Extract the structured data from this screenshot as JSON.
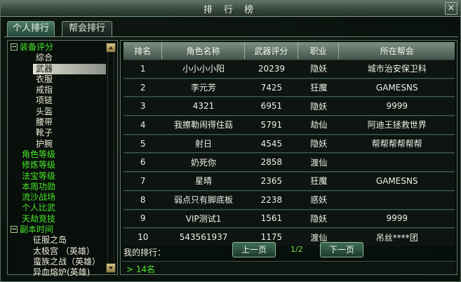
{
  "window": {
    "title": "排 行 榜",
    "close_label": "×"
  },
  "tabs": [
    {
      "label": "个人排行"
    },
    {
      "label": "帮会排行"
    }
  ],
  "sidebar": {
    "cat1": "装备评分",
    "sub": [
      "综合",
      "武器",
      "衣服",
      "戒指",
      "项链",
      "头盔",
      "腰带",
      "靴子",
      "护腕"
    ],
    "cats": [
      "角色等级",
      "修炼等级",
      "法宝等级",
      "本周功勋",
      "流沙战场",
      "个人比武",
      "天劫竞技"
    ],
    "cat_last": "副本时间",
    "sub2": [
      "征服之岛",
      "太极宫 （英雄）",
      "蛮族之战（英雄）",
      "异血熔炉(英雄)"
    ]
  },
  "table": {
    "headers": [
      "排名",
      "角色名称",
      "武器评分",
      "职业",
      "所在帮会"
    ],
    "rows": [
      [
        "1",
        "小小小小阳",
        "20239",
        "隐妖",
        "城市治安保卫科"
      ],
      [
        "2",
        "李元芳",
        "7425",
        "狂魔",
        "GAMESNS"
      ],
      [
        "3",
        "4321",
        "6951",
        "隐妖",
        "9999"
      ],
      [
        "4",
        "我擦勒闹得住菇",
        "5791",
        "劫仙",
        "阿迪王拯救世界"
      ],
      [
        "5",
        "射日",
        "4545",
        "隐妖",
        "帮帮帮帮帮帮"
      ],
      [
        "6",
        "奶死你",
        "2858",
        "渡仙",
        ""
      ],
      [
        "7",
        "星晴",
        "2365",
        "狂魔",
        "GAMESNS"
      ],
      [
        "8",
        "弱点只有脚底板",
        "2238",
        "惑妖",
        ""
      ],
      [
        "9",
        "VIP测试1",
        "1561",
        "隐妖",
        "9999"
      ],
      [
        "10",
        "543561937",
        "1175",
        "渡仙",
        "吊丝****团"
      ]
    ]
  },
  "footer": {
    "my_rank_label": "我的排行：",
    "prev": "上一页",
    "page": "1/2",
    "next": "下一页",
    "rank_value": "> 14名"
  }
}
